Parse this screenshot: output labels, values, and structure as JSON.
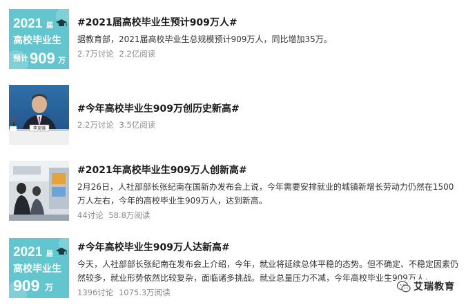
{
  "topics": [
    {
      "title": "#2021届高校毕业生预计909万人#",
      "desc": "据教育部，2021届高校毕业生总规模预计909万人，同比增加35万。",
      "discussions": "2.7万讨论",
      "reads": "2.2亿阅读",
      "thumb": {
        "type": "text-card",
        "bg": "#63c6cf",
        "line1": "2021",
        "line1_small": "届",
        "line2": "高校毕业生",
        "line3_prefix": "预计",
        "line3_num": "909",
        "line3_suffix": "万"
      }
    },
    {
      "title": "#今年高校毕业生909万创历史新高#",
      "desc": "",
      "discussions": "2.2万讨论",
      "reads": "3.5亿阅读",
      "thumb": {
        "type": "press-photo",
        "nameplate": "李克强"
      }
    },
    {
      "title": "#2021年高校毕业生909万人创新高#",
      "desc": "2月26日，人社部部长张纪南在国新办发布会上说，今年需要安排就业的城镇新增长劳动力仍然在1500万人左右，今年的高校毕业生909万人，达到新高。",
      "discussions": "44讨论",
      "reads": "58.8万阅读",
      "thumb": {
        "type": "photo-office"
      }
    },
    {
      "title": "#今年高校毕业生909万人达新高#",
      "desc": "今天，人社部部长张纪南在发布会上介绍，今年，就业将延续总体平稳的态势。但不确定、不稳定因素仍然较多，就业形势依然比较复杂，面临诸多挑战。就业总量压力不减，今年高校毕业生909万人，...",
      "discussions": "1396讨论",
      "reads": "1075.3万阅读",
      "thumb": {
        "type": "text-card",
        "bg": "#63c6cf",
        "line1": "2021",
        "line1_small": "届",
        "line2": "高校毕业生",
        "line3_prefix": "",
        "line3_num": "909",
        "line3_suffix": "万"
      }
    }
  ],
  "watermark": {
    "text": "艾瑞教育",
    "icon": "wechat-icon"
  }
}
